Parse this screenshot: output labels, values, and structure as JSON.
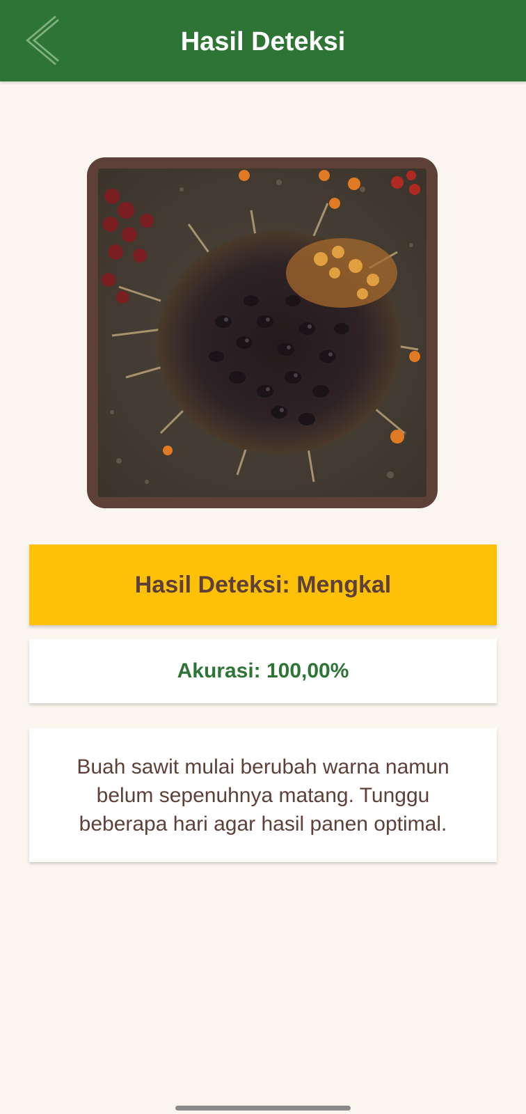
{
  "app_bar": {
    "title": "Hasil Deteksi",
    "back_icon": "chevron-left-icon",
    "color": "#2e7535"
  },
  "image": {
    "subject": "palm oil fruit bunch photo",
    "frame_color": "#5d4037"
  },
  "result": {
    "label": "Hasil Deteksi: Mengkal",
    "color": "#ffc107"
  },
  "accuracy": {
    "label": "Akurasi: 100,00%"
  },
  "description": {
    "text": "Buah sawit mulai berubah warna namun belum sepenuhnya matang. Tunggu beberapa hari agar hasil panen optimal."
  }
}
